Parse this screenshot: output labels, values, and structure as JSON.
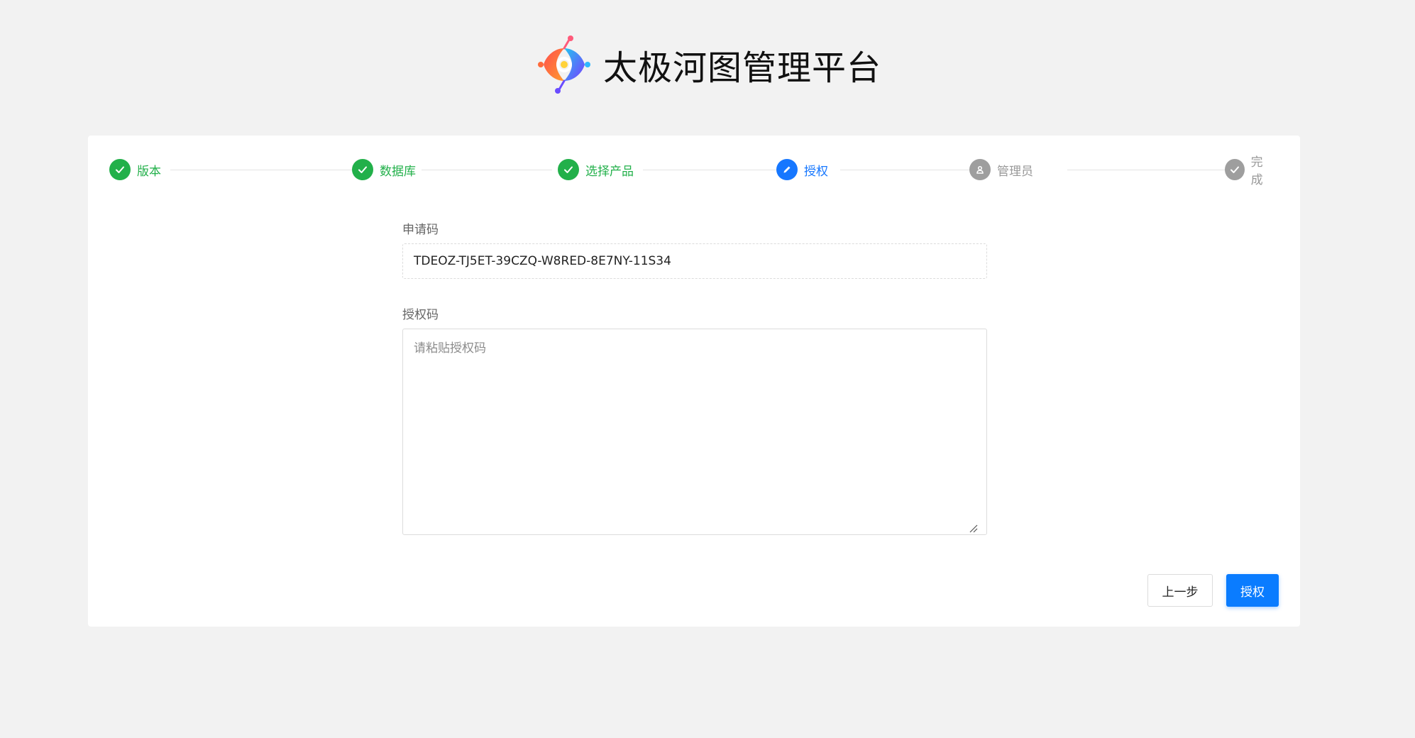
{
  "app": {
    "title": "太极河图管理平台"
  },
  "steps": [
    {
      "label": "版本",
      "status": "done",
      "icon": "check-icon"
    },
    {
      "label": "数据库",
      "status": "done",
      "icon": "check-icon"
    },
    {
      "label": "选择产品",
      "status": "done",
      "icon": "check-icon"
    },
    {
      "label": "授权",
      "status": "active",
      "icon": "pencil-icon"
    },
    {
      "label": "管理员",
      "status": "pending",
      "icon": "user-icon"
    },
    {
      "label": "完成",
      "status": "pending",
      "icon": "check-icon"
    }
  ],
  "form": {
    "request_code_label": "申请码",
    "request_code_value": "TDEOZ-TJ5ET-39CZQ-W8RED-8E7NY-11S34",
    "auth_code_label": "授权码",
    "auth_code_placeholder": "请粘贴授权码",
    "auth_code_value": ""
  },
  "buttons": {
    "prev": "上一步",
    "authorize": "授权"
  },
  "colors": {
    "done": "#22b04a",
    "active": "#1677ff",
    "pending": "#9e9e9e",
    "primary": "#0a7cff",
    "background": "#f2f2f2"
  }
}
